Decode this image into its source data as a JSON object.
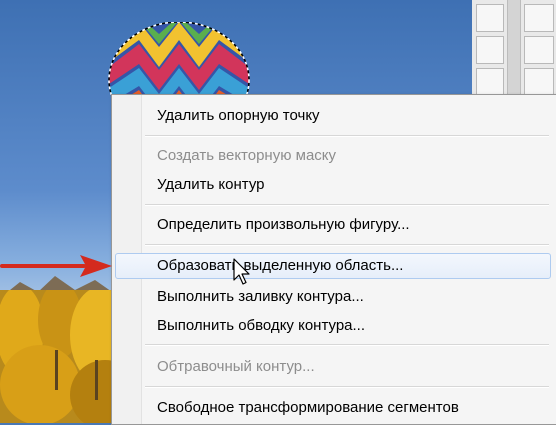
{
  "context_menu": {
    "items": [
      {
        "label": "Удалить опорную точку",
        "enabled": true
      },
      {
        "label": "Создать векторную маску",
        "enabled": false
      },
      {
        "label": "Удалить контур",
        "enabled": true
      },
      {
        "label": "Определить произвольную фигуру...",
        "enabled": true
      },
      {
        "label": "Образовать выделенную область...",
        "enabled": true,
        "highlighted": true
      },
      {
        "label": "Выполнить заливку контура...",
        "enabled": true
      },
      {
        "label": "Выполнить обводку контура...",
        "enabled": true
      },
      {
        "label": "Обтравочный контур...",
        "enabled": false
      },
      {
        "label": "Свободное трансформирование сегментов",
        "enabled": true
      }
    ]
  },
  "colors": {
    "arrow": "#d42a1e",
    "highlight_border": "#aecbf0",
    "disabled_text": "#8d8d8d"
  },
  "icons": [
    "red-arrow-icon",
    "mouse-pointer-icon"
  ]
}
